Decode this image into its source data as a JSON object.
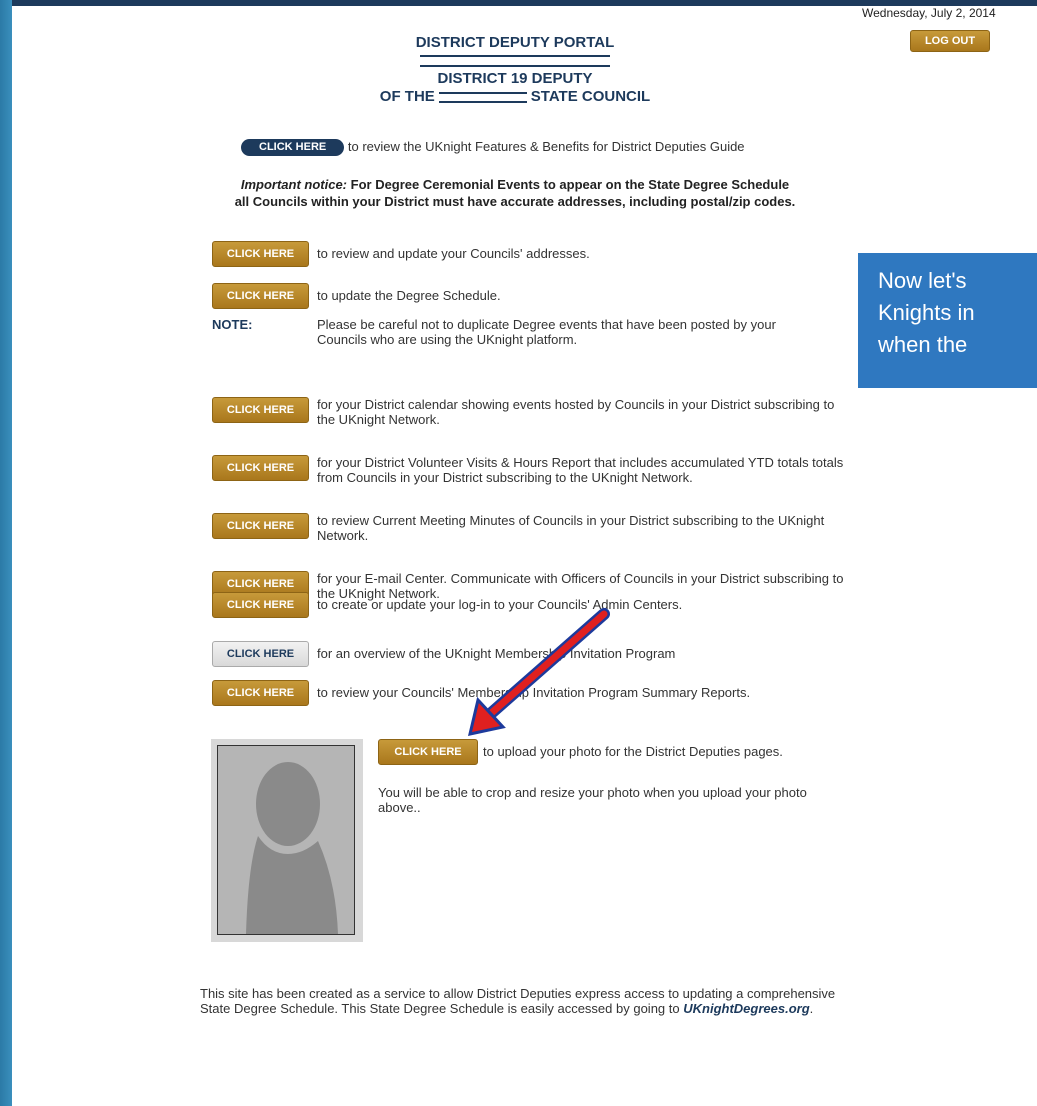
{
  "date": "Wednesday, July 2, 2014",
  "logout_label": "LOG OUT",
  "header": {
    "title": "DISTRICT DEPUTY PORTAL",
    "district": "DISTRICT 19 DEPUTY",
    "council_prefix": "OF THE",
    "council_suffix": "STATE COUNCIL"
  },
  "guide": {
    "button_label": "CLICK HERE",
    "text": "to review the UKnight Features & Benefits for District Deputies Guide"
  },
  "notice": {
    "lead": "Important notice:",
    "line1": "For Degree Ceremonial Events to appear on the State Degree Schedule",
    "line2": "all Councils within your District must have accurate addresses, including postal/zip codes."
  },
  "rows": [
    {
      "button": "CLICK HERE",
      "text": "to review and update your Councils' addresses."
    },
    {
      "button": "CLICK HERE",
      "text": "to update the Degree Schedule."
    },
    {
      "button": "CLICK HERE",
      "text": "for your District calendar showing events hosted by Councils in your District subscribing to the UKnight Network."
    },
    {
      "button": "CLICK HERE",
      "text": "for your District Volunteer Visits & Hours Report that includes accumulated YTD totals totals from Councils in your District subscribing to the UKnight Network."
    },
    {
      "button": "CLICK HERE",
      "text": "to review Current Meeting Minutes of Councils in your District subscribing to the UKnight Network."
    },
    {
      "button": "CLICK HERE",
      "text": "for your E-mail Center. Communicate with Officers of Councils in your District subscribing to the UKnight Network."
    },
    {
      "button": "CLICK HERE",
      "text": "to create or update your log-in to your Councils' Admin Centers."
    },
    {
      "button": "CLICK HERE",
      "text": "for an overview of the UKnight Membership Invitation Program"
    },
    {
      "button": "CLICK HERE",
      "text": "to review your Councils' Membership Invitation Program Summary Reports."
    }
  ],
  "note": {
    "label": "NOTE:",
    "text": "Please be careful not to duplicate Degree events that have been posted by your Councils who are using the UKnight platform."
  },
  "callout": {
    "line1": "Now let's",
    "line2": "Knights in",
    "line3": "when the"
  },
  "upload": {
    "button": "CLICK HERE",
    "text": "to upload your photo for the District Deputies pages.",
    "crop_text": "You will be able to crop and resize your photo when you upload your photo above.."
  },
  "footer": {
    "text": "This site has been created as a service to allow District Deputies express access to updating a comprehensive State Degree Schedule. This State Degree Schedule is easily accessed by going to",
    "link": "UKnightDegrees.org",
    "end": "."
  },
  "colors": {
    "gold": "#b88a2a",
    "navy": "#1d3a5c",
    "callout": "#2f78c0",
    "arrow": "#e02020"
  }
}
